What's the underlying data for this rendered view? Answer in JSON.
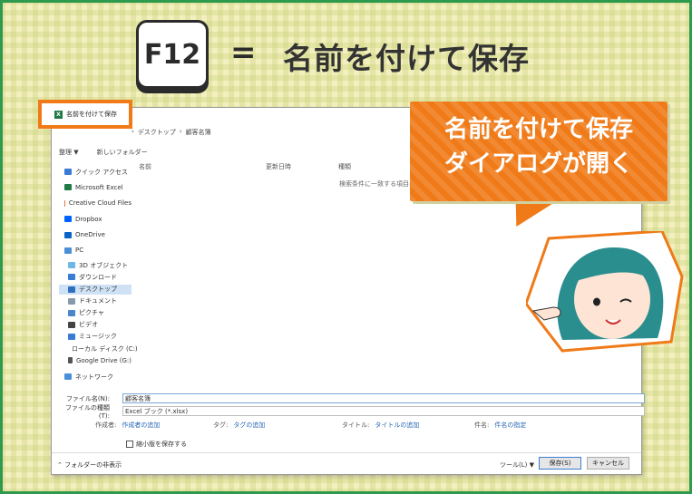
{
  "header": {
    "key": "F12",
    "equals": "=",
    "title": "名前を付けて保存"
  },
  "dialog": {
    "title": "名前を付けて保存",
    "breadcrumb": [
      "デスクトップ",
      "顧客名簿"
    ],
    "toolbar": [
      "整理 ▼",
      "新しいフォルダー"
    ],
    "nav_items": [
      {
        "label": "クイック アクセス",
        "type": "star",
        "sub": false
      },
      {
        "label": "Microsoft Excel",
        "type": "excel",
        "sub": false
      },
      {
        "label": "Creative Cloud Files",
        "type": "cc",
        "sub": false
      },
      {
        "label": "Dropbox",
        "type": "dropbox",
        "sub": false
      },
      {
        "label": "OneDrive",
        "type": "onedrive",
        "sub": false
      },
      {
        "label": "PC",
        "type": "pc",
        "sub": false
      },
      {
        "label": "3D オブジェクト",
        "type": "folder",
        "sub": true
      },
      {
        "label": "ダウンロード",
        "type": "download",
        "sub": true
      },
      {
        "label": "デスクトップ",
        "type": "desktop",
        "sub": true,
        "selected": true
      },
      {
        "label": "ドキュメント",
        "type": "doc",
        "sub": true
      },
      {
        "label": "ピクチャ",
        "type": "pic",
        "sub": true
      },
      {
        "label": "ビデオ",
        "type": "video",
        "sub": true
      },
      {
        "label": "ミュージック",
        "type": "music",
        "sub": true
      },
      {
        "label": "ローカル ディスク (C:)",
        "type": "disk",
        "sub": true
      },
      {
        "label": "Google Drive (G:)",
        "type": "gdrive",
        "sub": true
      },
      {
        "label": "ネットワーク",
        "type": "network",
        "sub": false
      }
    ],
    "columns": [
      "名前",
      "更新日時",
      "種類"
    ],
    "empty_message": "検索条件に一致する項目は",
    "filename_label": "ファイル名(N):",
    "filename_value": "顧客名簿",
    "filetype_label": "ファイルの種類(T):",
    "filetype_value": "Excel ブック (*.xlsx)",
    "author_label": "作成者:",
    "author_link": "作成者の追加",
    "tags_label": "タグ:",
    "tags_link": "タグの追加",
    "titlefield_label": "タイトル:",
    "titlefield_link": "タイトルの追加",
    "subject_label": "件名:",
    "subject_link": "件名の指定",
    "thumbnail_label": "縮小版を保存する",
    "hide_folders": "フォルダーの非表示",
    "tools_label": "ツール(L)",
    "tools_arrow": "▼",
    "save_button": "保存(S)",
    "cancel_button": "キャンセル"
  },
  "bubble": {
    "line1": "名前を付けて保存",
    "line2": "ダイアログが開く"
  },
  "colors": {
    "accent": "#ef7a17",
    "frame": "#2f9a4e",
    "background": "#f3efbe"
  }
}
